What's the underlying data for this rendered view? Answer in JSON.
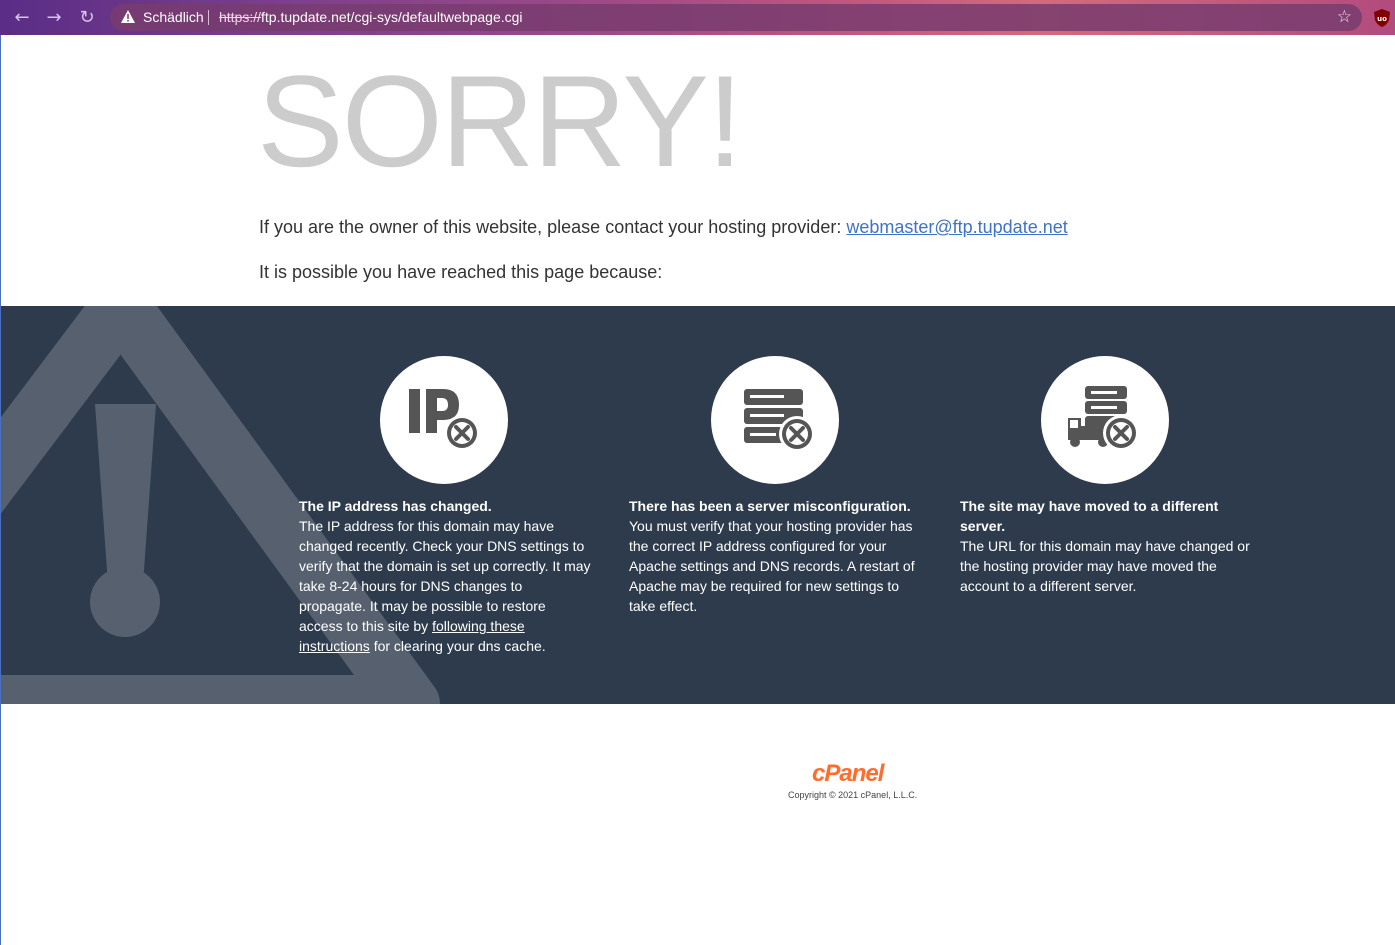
{
  "browser": {
    "security_status": "Schädlich",
    "url_scheme": "https://",
    "url_rest": "ftp.tupdate.net/cgi-sys/defaultwebpage.cgi"
  },
  "page": {
    "heading": "SORRY!",
    "owner_text": "If you are the owner of this website, please contact your hosting provider: ",
    "contact_email": "webmaster@ftp.tupdate.net",
    "reasons_intro": "It is possible you have reached this page because:",
    "reasons": [
      {
        "icon": "ip-error-icon",
        "title": "The IP address has changed.",
        "body": "The IP address for this domain may have changed recently. Check your DNS settings to verify that the domain is set up correctly. It may take 8-24 hours for DNS changes to propagate. It may be possible to restore access to this site by ",
        "link": "following these instructions",
        "body_after": " for clearing your dns cache."
      },
      {
        "icon": "server-error-icon",
        "title": "There has been a server misconfiguration.",
        "body": "You must verify that your hosting provider has the correct IP address configured for your Apache settings and DNS records. A restart of Apache may be required for new settings to take effect."
      },
      {
        "icon": "server-moved-icon",
        "title": "The site may have moved to a different server.",
        "body": "The URL for this domain may have changed or the hosting provider may have moved the account to a different server."
      }
    ],
    "footer_logo": "cPanel",
    "copyright": "Copyright © 2021 cPanel, L.L.C."
  },
  "colors": {
    "band": "#2d3b4c",
    "heading": "#cccccc",
    "link": "#3d74c7",
    "cpanel_orange": "#ff6c2c"
  }
}
